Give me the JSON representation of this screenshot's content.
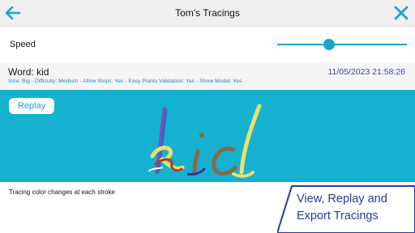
{
  "header": {
    "title": "Tom's Tracings",
    "back_icon": "back-arrow-icon",
    "close_icon": "close-icon",
    "accent": "#1aa6c9"
  },
  "speed": {
    "label": "Speed",
    "value": 0.4
  },
  "tracing": {
    "word_label": "Word: kid",
    "date": "11/05/2023 21:58:26",
    "details": "Size: Big - Difficulty: Medium - Allow Stops: Yes - Easy Points Validation: Yes - Show Model: Yes"
  },
  "canvas": {
    "replay_label": "Replay",
    "background": "#15b1d0"
  },
  "note": "Tracing color changes at each stroke",
  "promo": {
    "line1": "View, Replay and",
    "line2": "Export Tracings"
  }
}
